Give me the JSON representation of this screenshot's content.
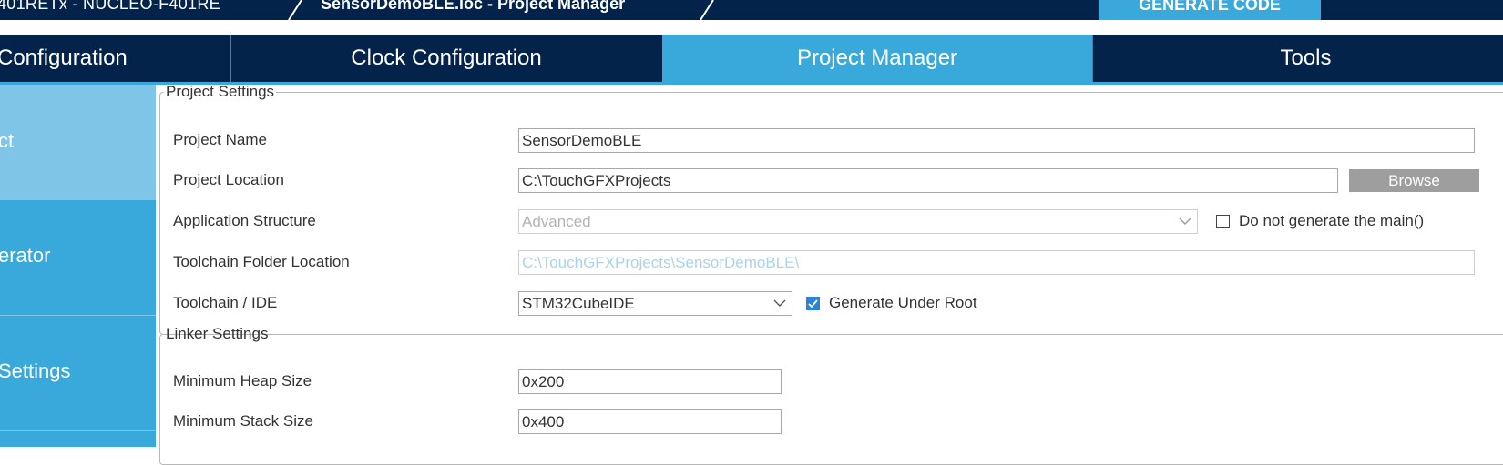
{
  "breadcrumb": {
    "device": "401RETx - NUCLEO-F401RE",
    "file": "SensorDemoBLE.ioc - Project Manager"
  },
  "toolbar": {
    "generate_code": "GENERATE CODE"
  },
  "tabs": [
    {
      "label": "Configuration"
    },
    {
      "label": "Clock Configuration"
    },
    {
      "label": "Project Manager"
    },
    {
      "label": "Tools"
    }
  ],
  "sidebar": {
    "items": [
      {
        "label": "ct"
      },
      {
        "label": "erator"
      },
      {
        "label": "Settings"
      }
    ]
  },
  "project_settings": {
    "title": "Project Settings",
    "project_name_label": "Project Name",
    "project_name_value": "SensorDemoBLE",
    "project_location_label": "Project Location",
    "project_location_value": "C:\\TouchGFXProjects",
    "browse_label": "Browse",
    "app_structure_label": "Application Structure",
    "app_structure_value": "Advanced",
    "no_main_label": "Do not generate the main()",
    "no_main_checked": false,
    "toolchain_folder_label": "Toolchain Folder Location",
    "toolchain_folder_value": "C:\\TouchGFXProjects\\SensorDemoBLE\\",
    "toolchain_ide_label": "Toolchain / IDE",
    "toolchain_ide_value": "STM32CubeIDE",
    "generate_under_root_label": "Generate Under Root",
    "generate_under_root_checked": true
  },
  "linker_settings": {
    "title": "Linker Settings",
    "heap_label": "Minimum Heap Size",
    "heap_value": "0x200",
    "stack_label": "Minimum Stack Size",
    "stack_value": "0x400"
  },
  "colors": {
    "navy": "#03234b",
    "accent": "#39a9db",
    "sidebar_active": "#7fc5e8",
    "browse_button": "#9e9e9e",
    "checkbox_checked": "#2b83d8"
  },
  "icons": [
    "chevron-down-icon",
    "checkbox-icon",
    "checkmark-icon"
  ]
}
